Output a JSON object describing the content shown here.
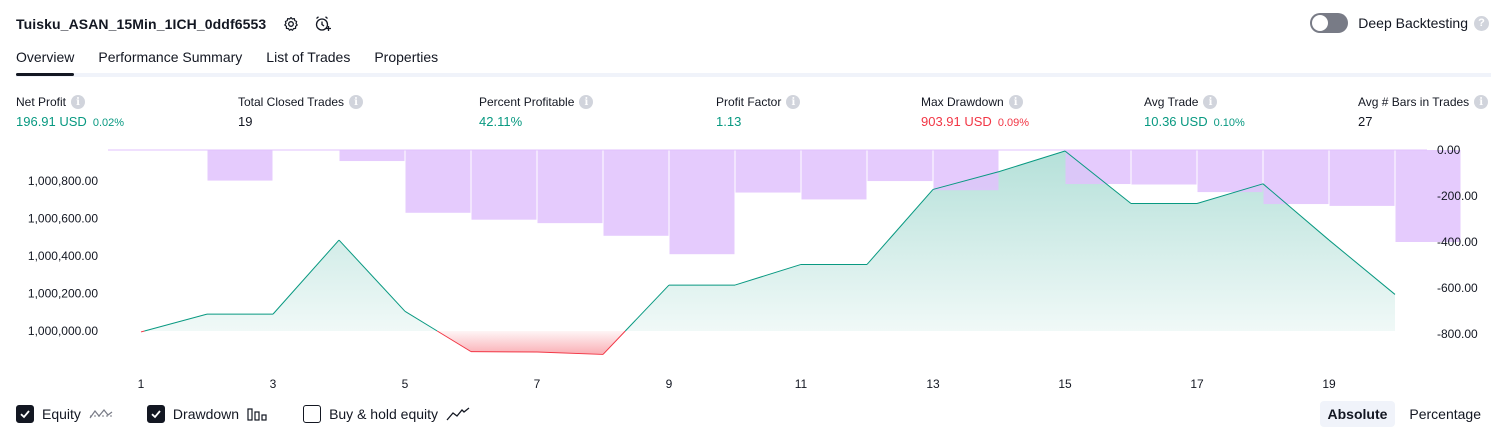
{
  "header": {
    "title": "Tuisku_ASAN_15Min_1ICH_0ddf6553",
    "deep_backtesting_label": "Deep Backtesting",
    "help_glyph": "?"
  },
  "tabs": [
    {
      "label": "Overview",
      "active": true
    },
    {
      "label": "Performance Summary",
      "active": false
    },
    {
      "label": "List of Trades",
      "active": false
    },
    {
      "label": "Properties",
      "active": false
    }
  ],
  "metrics": [
    {
      "label": "Net Profit",
      "value": "196.91 USD",
      "pct": "0.02%",
      "color": "#089981"
    },
    {
      "label": "Total Closed Trades",
      "value": "19",
      "pct": "",
      "color": "#131722"
    },
    {
      "label": "Percent Profitable",
      "value": "42.11%",
      "pct": "",
      "color": "#089981"
    },
    {
      "label": "Profit Factor",
      "value": "1.13",
      "pct": "",
      "color": "#089981"
    },
    {
      "label": "Max Drawdown",
      "value": "903.91 USD",
      "pct": "0.09%",
      "color": "#f23645"
    },
    {
      "label": "Avg Trade",
      "value": "10.36 USD",
      "pct": "0.10%",
      "color": "#089981"
    },
    {
      "label": "Avg # Bars in Trades",
      "value": "27",
      "pct": "",
      "color": "#131722"
    }
  ],
  "info_glyph": "i",
  "chart_data": {
    "type": "line",
    "x": [
      1,
      2,
      3,
      4,
      5,
      6,
      7,
      8,
      9,
      10,
      11,
      12,
      13,
      14,
      15,
      16,
      17,
      18,
      19,
      20
    ],
    "x_ticks": [
      1,
      3,
      5,
      7,
      9,
      11,
      13,
      15,
      17,
      19
    ],
    "series": [
      {
        "type": "area",
        "values": [
          999995,
          1000090,
          1000090,
          1000485,
          1000105,
          999890,
          999888,
          999875,
          1000245,
          1000245,
          1000355,
          1000355,
          1000755,
          1000850,
          1000960,
          1000680,
          1000680,
          1000785,
          1000485,
          1000195
        ],
        "baseline": 1000000,
        "color_above": "#089981",
        "color_below": "#f23645"
      },
      {
        "type": "bar",
        "axis": "right",
        "values": [
          0,
          -133,
          0,
          -48,
          -273,
          -303,
          -318,
          -373,
          -453,
          -185,
          -215,
          -135,
          -175,
          0,
          -148,
          -150,
          -183,
          -235,
          -243,
          -400
        ],
        "color": "#e1c2fd"
      }
    ],
    "y_left": {
      "ticks": [
        "1,000,000.00",
        "1,000,200.00",
        "1,000,400.00",
        "1,000,600.00",
        "1,000,800.00"
      ],
      "values": [
        1000000,
        1000200,
        1000400,
        1000600,
        1000800
      ],
      "range": [
        999850,
        1000970
      ]
    },
    "y_right": {
      "ticks": [
        "0.00",
        "-200.00",
        "-400.00",
        "-600.00",
        "-800.00"
      ],
      "values": [
        0,
        -200,
        -400,
        -600,
        -800
      ],
      "range": [
        -905,
        0
      ]
    },
    "grid": false,
    "legend": "bottom-left"
  },
  "legend": [
    {
      "label": "Equity",
      "checked": true
    },
    {
      "label": "Drawdown",
      "checked": true
    },
    {
      "label": "Buy & hold equity",
      "checked": false
    }
  ],
  "check_glyph": "✓",
  "modes": [
    {
      "label": "Absolute",
      "active": true
    },
    {
      "label": "Percentage",
      "active": false
    }
  ]
}
